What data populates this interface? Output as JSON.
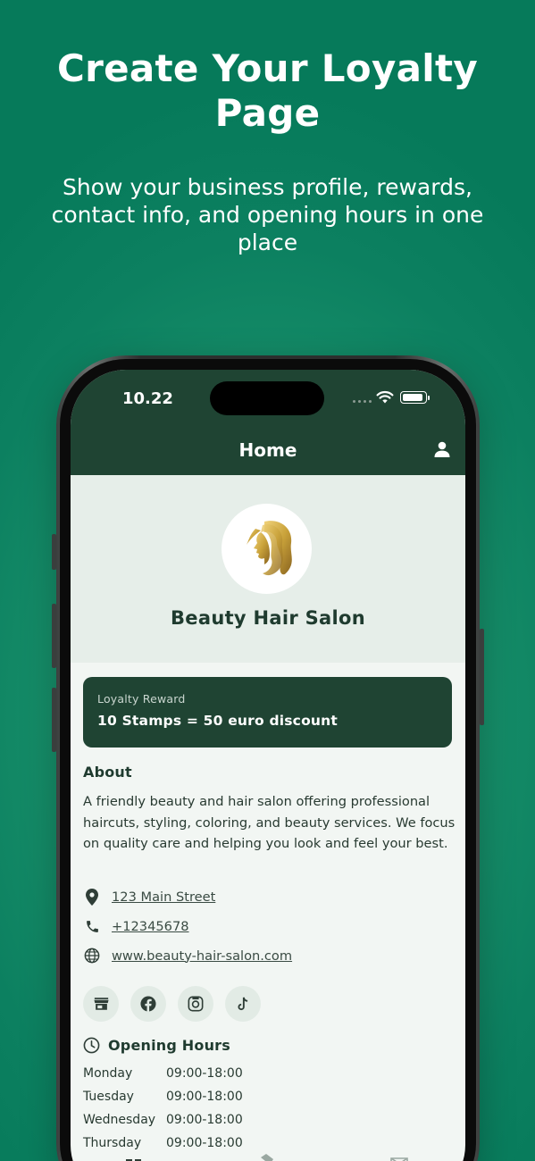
{
  "marketing": {
    "headline": "Create Your Loyalty Page",
    "subheadline": "Show your business profile, rewards, contact info, and opening hours in one place"
  },
  "status_bar": {
    "time": "10.22"
  },
  "nav": {
    "title": "Home"
  },
  "business": {
    "name": "Beauty Hair Salon",
    "logo_icon": "woman-profile-gold-icon"
  },
  "reward": {
    "label": "Loyalty Reward",
    "value": "10 Stamps = 50 euro discount"
  },
  "about": {
    "title": "About",
    "text": "A friendly beauty and hair salon offering professional haircuts, styling, coloring, and beauty services. We focus on quality care and helping you look and feel your best."
  },
  "contact": {
    "address": "123 Main Street",
    "phone": "+12345678",
    "website": "www.beauty-hair-salon.com"
  },
  "social": [
    "store-icon",
    "facebook-icon",
    "instagram-icon",
    "tiktok-icon"
  ],
  "hours": {
    "title": "Opening Hours",
    "rows": [
      {
        "day": "Monday",
        "time": "09:00-18:00"
      },
      {
        "day": "Tuesday",
        "time": "09:00-18:00"
      },
      {
        "day": "Wednesday",
        "time": "09:00-18:00"
      },
      {
        "day": "Thursday",
        "time": "09:00-18:00"
      }
    ]
  },
  "colors": {
    "background": "#0c8060",
    "header": "#1f4433",
    "accent_gold": "#c9a23a"
  }
}
